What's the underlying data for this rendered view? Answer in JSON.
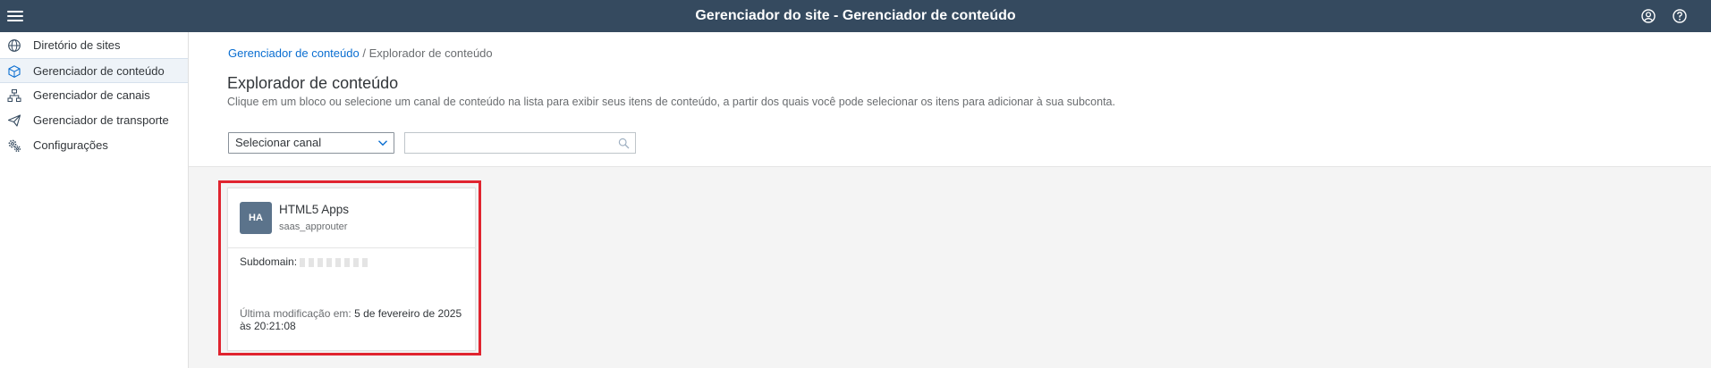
{
  "shellbar": {
    "title": "Gerenciador do site - Gerenciador de conteúdo",
    "menu_icon": "hamburger-icon",
    "user_icon": "user-icon",
    "help_icon": "help-icon",
    "background": "#354a5f"
  },
  "sidebar": {
    "items": [
      {
        "label": "Diretório de sites",
        "icon": "globe-icon",
        "active": false
      },
      {
        "label": "Gerenciador de conteúdo",
        "icon": "cube-icon",
        "active": true
      },
      {
        "label": "Gerenciador de canais",
        "icon": "hierarchy-icon",
        "active": false
      },
      {
        "label": "Gerenciador de transporte",
        "icon": "paper-plane-icon",
        "active": false
      },
      {
        "label": "Configurações",
        "icon": "gears-icon",
        "active": false
      }
    ]
  },
  "breadcrumb": {
    "link": "Gerenciador de conteúdo",
    "separator": "/",
    "current": "Explorador de conteúdo"
  },
  "page": {
    "title": "Explorador de conteúdo",
    "description": "Clique em um bloco ou selecione um canal de conteúdo na lista para exibir seus itens de conteúdo, a partir dos quais você pode selecionar os itens para adicionar à sua subconta."
  },
  "filters": {
    "channel_select": "Selecionar canal",
    "search_value": "",
    "search_placeholder": ""
  },
  "tile": {
    "initials": "HA",
    "title": "HTML5 Apps",
    "subtitle": "saas_approuter",
    "subdomain_label": "Subdomain:",
    "modified_label": "Última modificação em:",
    "modified_value": "5 de fevereiro de 2025 às 20:21:08"
  },
  "colors": {
    "accent_link": "#0a6ed1",
    "highlight_border": "#e0242f",
    "avatar_bg": "#5b738b"
  }
}
